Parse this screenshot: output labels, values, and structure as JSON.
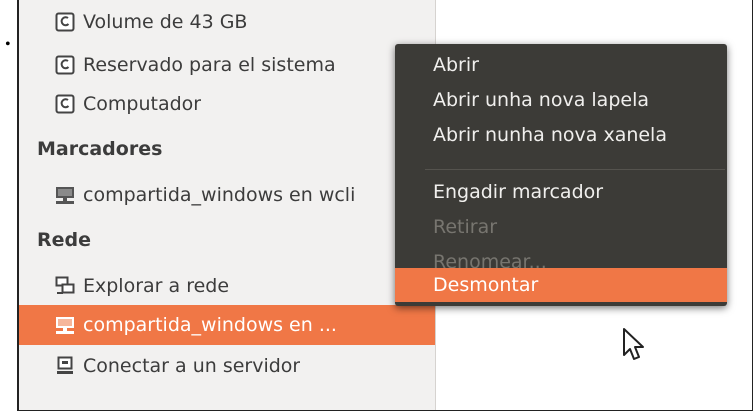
{
  "top_caption": "(... image truncated at the top ...)",
  "bullet": "•",
  "sidebar": {
    "items": [
      {
        "label": "Volume de 43 GB",
        "icon": "drive-icon"
      },
      {
        "label": "Reservado para el sistema",
        "icon": "drive-icon"
      },
      {
        "label": "Computador",
        "icon": "drive-icon"
      }
    ],
    "bookmarks_header": "Marcadores",
    "bookmarks": [
      {
        "label": "compartida_windows en wcli",
        "icon": "network-folder-icon"
      }
    ],
    "network_header": "Rede",
    "network": [
      {
        "label": "Explorar a rede",
        "icon": "network-icon"
      },
      {
        "label": "compartida_windows en ...",
        "icon": "network-folder-icon",
        "selected": true
      },
      {
        "label": "Conectar a un servidor",
        "icon": "server-icon"
      }
    ]
  },
  "context_menu": {
    "items": [
      {
        "label": "Abrir",
        "enabled": true
      },
      {
        "label": "Abrir unha nova lapela",
        "enabled": true
      },
      {
        "label": "Abrir nunha nova xanela",
        "enabled": true
      },
      {
        "label": "Engadir marcador",
        "enabled": true
      },
      {
        "label": "Retirar",
        "enabled": false
      },
      {
        "label": "Renomear...",
        "enabled": false
      },
      {
        "label": "Desmontar",
        "enabled": true,
        "highlighted": true
      }
    ]
  },
  "colors": {
    "accent": "#f07746",
    "menu_bg": "#3c3b37",
    "sidebar_bg": "#f2f1f0"
  }
}
